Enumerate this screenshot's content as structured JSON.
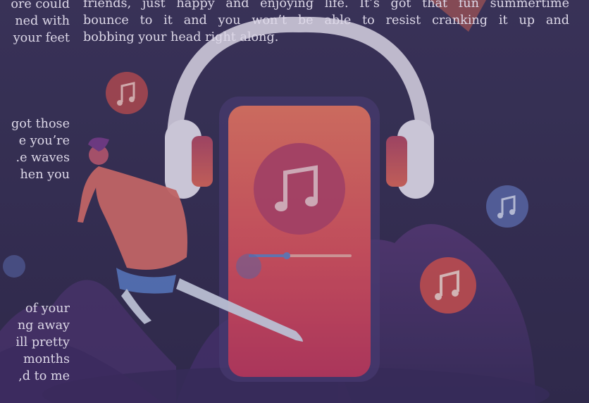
{
  "left_column": {
    "para1": [
      "ore could",
      "ned with",
      "your feet"
    ],
    "para2": [
      "got those",
      "e you’re",
      "e waves.",
      "hen you"
    ],
    "para3": [
      "of your",
      "ng away",
      "ill pretty",
      "months",
      "d to me,"
    ]
  },
  "right_column": {
    "lines": [
      "friends, just happy and enjoying life. It’s got that fun summertime",
      "bounce to it and you won’t be able to resist cranking it up and",
      "bobbing your head right along."
    ]
  },
  "colors": {
    "background": "#3b3558",
    "phone": "#e2685f",
    "headphones": "#e8e3f0",
    "disc": "#b9456b",
    "note_bubble_blue": "#6072b6",
    "note_bubble_red": "#d9544f",
    "text": "#ddd8e8"
  },
  "icons": [
    "music-note-icon",
    "headphones-icon",
    "phone-illustration",
    "dancer-illustration"
  ]
}
